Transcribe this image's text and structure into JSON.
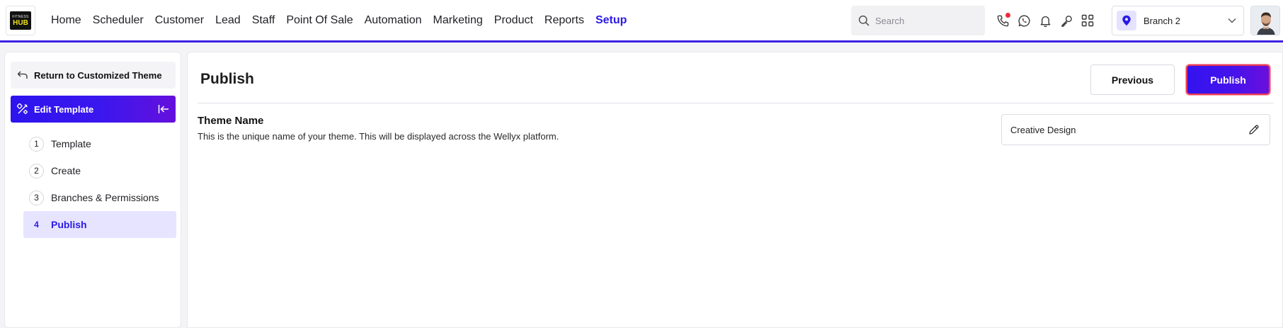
{
  "brand": {
    "logo_line1": "FITNESS",
    "logo_line2": "HUB"
  },
  "nav": {
    "items": [
      "Home",
      "Scheduler",
      "Customer",
      "Lead",
      "Staff",
      "Point Of Sale",
      "Automation",
      "Marketing",
      "Product",
      "Reports",
      "Setup"
    ],
    "active": "Setup"
  },
  "search": {
    "placeholder": "Search"
  },
  "toolbar_icons": [
    "phone-icon",
    "whatsapp-icon",
    "bell-icon",
    "key-icon",
    "apps-grid-icon"
  ],
  "branch": {
    "label": "Branch 2"
  },
  "sidebar": {
    "return_label": "Return to Customized Theme",
    "edit_template_label": "Edit Template",
    "steps": [
      {
        "num": "1",
        "label": "Template"
      },
      {
        "num": "2",
        "label": "Create"
      },
      {
        "num": "3",
        "label": "Branches & Permissions"
      },
      {
        "num": "4",
        "label": "Publish"
      }
    ],
    "active_step": "4"
  },
  "main": {
    "title": "Publish",
    "previous_label": "Previous",
    "publish_label": "Publish",
    "field": {
      "title": "Theme Name",
      "description": "This is the unique name of your theme. This will be displayed across the Wellyx platform.",
      "value": "Creative Design"
    }
  },
  "colors": {
    "accent": "#2b1ae6",
    "accent_light": "#e6e4ff",
    "notification": "#ef2b3c"
  }
}
